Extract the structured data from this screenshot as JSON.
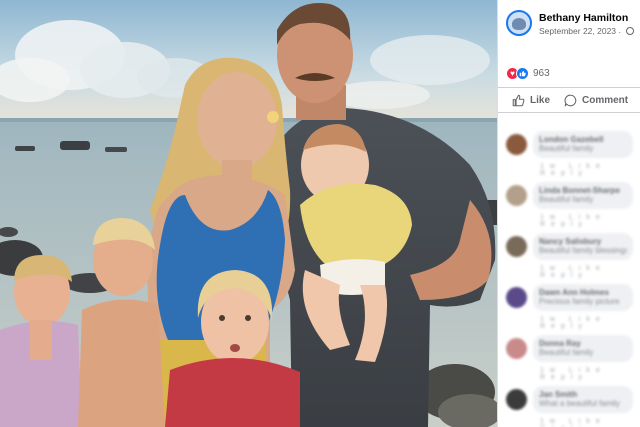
{
  "post": {
    "author": "Bethany Hamilton",
    "date": "September 22, 2023",
    "meta_separator": "·",
    "reaction_count": "963",
    "reaction_icons": [
      "love-icon",
      "like-icon"
    ]
  },
  "actions": {
    "like_label": "Like",
    "comment_label": "Comment"
  },
  "comments": [
    {
      "avatar_color": "#8a5a3c",
      "name": "London Gazebell",
      "text": "Beautiful family",
      "actions": "1w Like Reply"
    },
    {
      "avatar_color": "#b3a08a",
      "name": "Linda Bonnet-Sharpe",
      "text": "Beautiful family",
      "actions": "1w Like Reply"
    },
    {
      "avatar_color": "#7a6a5a",
      "name": "Nancy Salisbury",
      "text": "Beautiful family blessings",
      "actions": "1w Like Reply"
    },
    {
      "avatar_color": "#5b4a8a",
      "name": "Dawn Ann Holmes",
      "text": "Precious family picture",
      "actions": "1w Like Reply"
    },
    {
      "avatar_color": "#c98a8a",
      "name": "Donna Ray",
      "text": "Beautiful family",
      "actions": "1w Like Reply"
    },
    {
      "avatar_color": "#3b3b3b",
      "name": "Jan Smith",
      "text": "What a beautiful family",
      "actions": "1w Like Reply"
    }
  ],
  "colors": {
    "accent": "#1877f2",
    "love": "#f0284a",
    "secondary_text": "#65676b"
  }
}
